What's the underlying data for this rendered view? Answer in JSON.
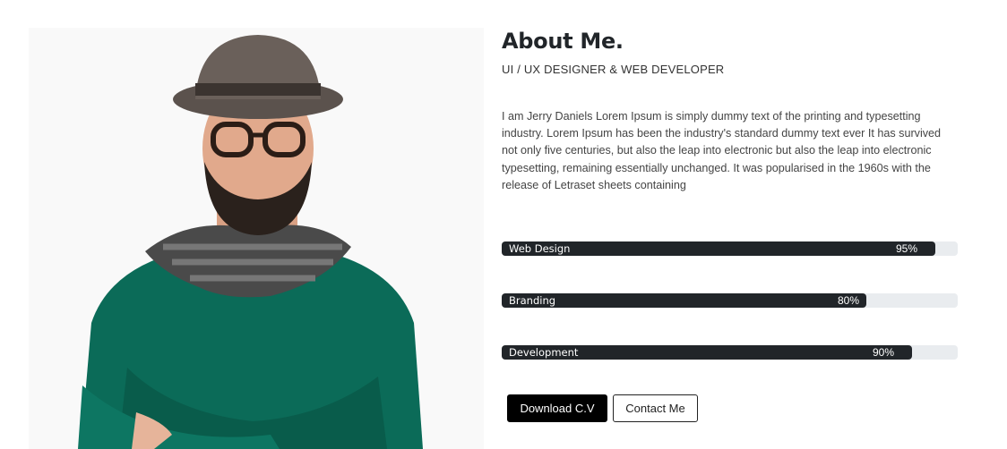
{
  "about": {
    "title": "About Me.",
    "subtitle": "UI / UX DESIGNER & WEB DEVELOPER",
    "description": "I am Jerry Daniels Lorem Ipsum is simply dummy text of the printing and typesetting industry. Lorem Ipsum has been the industry's standard dummy text ever It has survived not only five centuries, but also the leap into electronic but also the leap into electronic typesetting, remaining essentially unchanged. It was popularised in the 1960s with the release of Letraset sheets containing"
  },
  "skills": [
    {
      "label": "Web Design",
      "percent_text": "95%",
      "level": 0.95
    },
    {
      "label": "Branding",
      "percent_text": "80%",
      "level": 0.8
    },
    {
      "label": "Development",
      "percent_text": "90%",
      "level": 0.9
    }
  ],
  "buttons": {
    "download": "Download C.V",
    "contact": "Contact Me"
  },
  "colors": {
    "bar_fill": "#212529",
    "bar_track": "#e9ecef",
    "sweater": "#0b6b58"
  },
  "photo": {
    "subject": "portrait-photo"
  }
}
